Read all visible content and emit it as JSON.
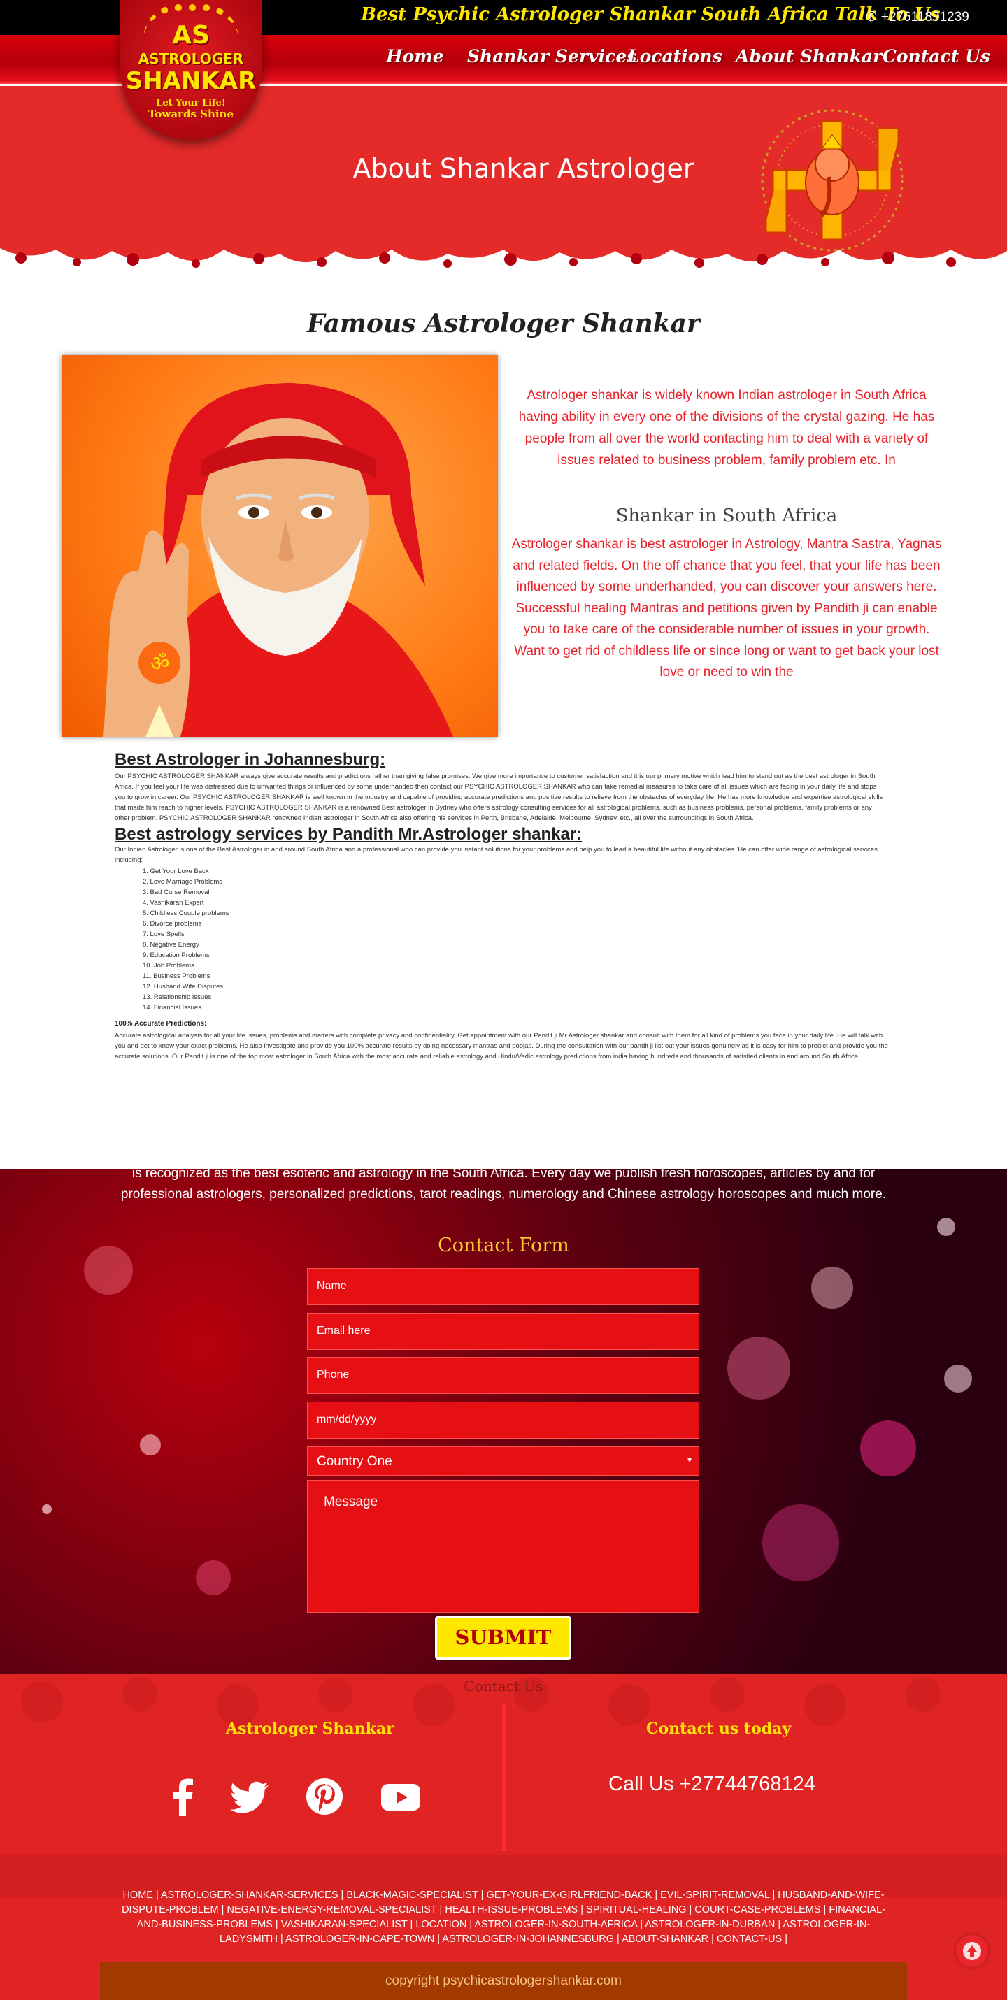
{
  "topbar": {
    "tagline": "Best Psychic Astrologer Shankar South Africa Talk To Us",
    "phone": "+27611891239"
  },
  "logo": {
    "initials": "AS",
    "line1": "ASTROLOGER",
    "line2": "SHANKAR",
    "slogan1": "Let Your Life!",
    "slogan2": "Towards Shine"
  },
  "nav": [
    "Home",
    "Shankar Services",
    "Locations",
    "About Shankar",
    "Contact Us"
  ],
  "hero": {
    "title": "About Shankar Astrologer"
  },
  "about": {
    "heading": "Famous Astrologer Shankar",
    "intro": "Astrologer shankar is widely known Indian astrologer in South Africa having ability in every one of the divisions of the crystal gazing. He has people from all over the world contacting him to deal with a variety of issues related to business problem, family problem etc. In",
    "sub_heading": "Shankar in South Africa",
    "sub_text": "Astrologer shankar is best astrologer in Astrology, Mantra Sastra, Yagnas and related fields. On the off chance that you feel, that your life has been influenced by some underhanded, you can discover your answers here. Successful healing Mantras and petitions given by Pandith ji can enable you to take care of the considerable number of issues in your growth. Want to get rid of childless life or since long or want to get back your lost love or need to win the"
  },
  "johannesburg": {
    "title": "Best Astrologer in Johannesburg:",
    "text": "Our PSYCHIC ASTROLOGER SHANKAR always give accurate results and predictions rather than giving false promises. We give more importance to customer satisfaction and it is our primary motive which lead him to stand out as the best astrologer in South Africa. If you feel your life was distressed due to unwanted things or influenced by some underhanded then contact our PSYCHIC ASTROLOGER SHANKAR who can take remedial measures to take care of all issues which are facing in your daily life and stops you to grow in career. Our PSYCHIC ASTROLOGER SHANKAR is well known in the industry and capable of providing accurate predictions and positive results to relieve from the obstacles of everyday life. He has more knowledge and expertise astrological skills that made him reach to higher levels. PSYCHIC ASTROLOGER SHANKAR is a renowned Best astrologer in Sydney who offers astrology consulting services for all astrological problems, such as business problems, personal problems, family problems or any other problem. PSYCHIC ASTROLOGER SHANKAR renowned Indian astrologer in South Africa also offering his services in Perth, Brisbane, Adelaide, Melbourne, Sydney, etc., all over the surroundings in South Africa."
  },
  "services": {
    "title": "Best astrology services by Pandith Mr.Astrologer shankar:",
    "text": "Our Indian Astrologer is one of the Best Astrologer in and around South Africa and a professional who can provide you instant solutions for your problems and help you to lead a beautiful life without any obstacles. He can offer wide range of astrological services including:",
    "list": [
      "1. Get Your Love Back",
      "2. Love Marriage Problems",
      "3. Bad Curse Removal",
      "4. Vashikaran Expert",
      "5. Childless Couple problems",
      "6. Divorce problems",
      "7. Love Spells",
      "8. Negative Energy",
      "9. Education Problems",
      "10. Job Problems",
      "11. Business Problems",
      "12. Husband Wife Disputes",
      "13. Relationship Issues",
      "14. Financial Issues"
    ],
    "accurate_title": "100% Accurate Predictions:",
    "accurate_text": "Accurate astrological analysis for all your life issues, problems and matters with complete privacy and confidentiality. Get appointment with our Pandit ji Mr.Astrologer shankar and consult with them for all kind of problems you face in your daily life. He will talk with you and get to know your exact problems. He also investigate and provide you 100% accurate results by doing necessary mantras and poojas. During the consultation with our pandit ji list out your issues genuinely as it is easy for him to predict and provide you the accurate solutions. Our Pandit ji is one of the top most astrologer in South Africa with the most accurate and reliable astrology and Hindu/Vedic astrology predictions from india having hundreds and thousands of satisfied clients in and around South Africa."
  },
  "contact": {
    "blurb": "is recognized as the best esoteric and astrology in the South Africa. Every day we publish fresh horoscopes, articles by and for professional astrologers, personalized predictions, tarot readings, numerology and Chinese astrology horoscopes and much more.",
    "form_title": "Contact Form",
    "name_placeholder": "Name",
    "email_placeholder": "Email here",
    "phone_placeholder": "Phone",
    "date_placeholder": "mm/dd/yyyy",
    "country_value": "Country One",
    "message_placeholder": "Message",
    "submit_label": "SUBMIT"
  },
  "footer": {
    "faint_title": "Contact Us",
    "left_title": "Astrologer Shankar",
    "right_title": "Contact us today",
    "call": "Call Us +27744768124",
    "social_icons": [
      "facebook-icon",
      "twitter-icon",
      "pinterest-icon",
      "youtube-icon"
    ],
    "links": [
      "HOME",
      "ASTROLOGER-SHANKAR-SERVICES",
      "BLACK-MAGIC-SPECIALIST",
      "GET-YOUR-EX-GIRLFRIEND-BACK",
      "EVIL-SPIRIT-REMOVAL",
      "HUSBAND-AND-WIFE-DISPUTE-PROBLEM",
      "NEGATIVE-ENERGY-REMOVAL-SPECIALIST",
      "HEALTH-ISSUE-PROBLEMS",
      "SPIRITUAL-HEALING",
      "COURT-CASE-PROBLEMS",
      "FINANCIAL-AND-BUSINESS-PROBLEMS",
      "VASHIKARAN-SPECIALIST",
      "LOCATION",
      "ASTROLOGER-IN-SOUTH-AFRICA",
      "ASTROLOGER-IN-DURBAN",
      "ASTROLOGER-IN-LADYSMITH",
      "ASTROLOGER-IN-CAPE-TOWN",
      "ASTROLOGER-IN-JOHANNESBURG",
      "ABOUT-SHANKAR",
      "CONTACT-US"
    ],
    "copyright": "copyright psychicastrologershankar.com"
  },
  "colors": {
    "brand_red": "#e52a2a",
    "accent_yellow": "#ffe600",
    "body_red_text": "#e8212a"
  }
}
